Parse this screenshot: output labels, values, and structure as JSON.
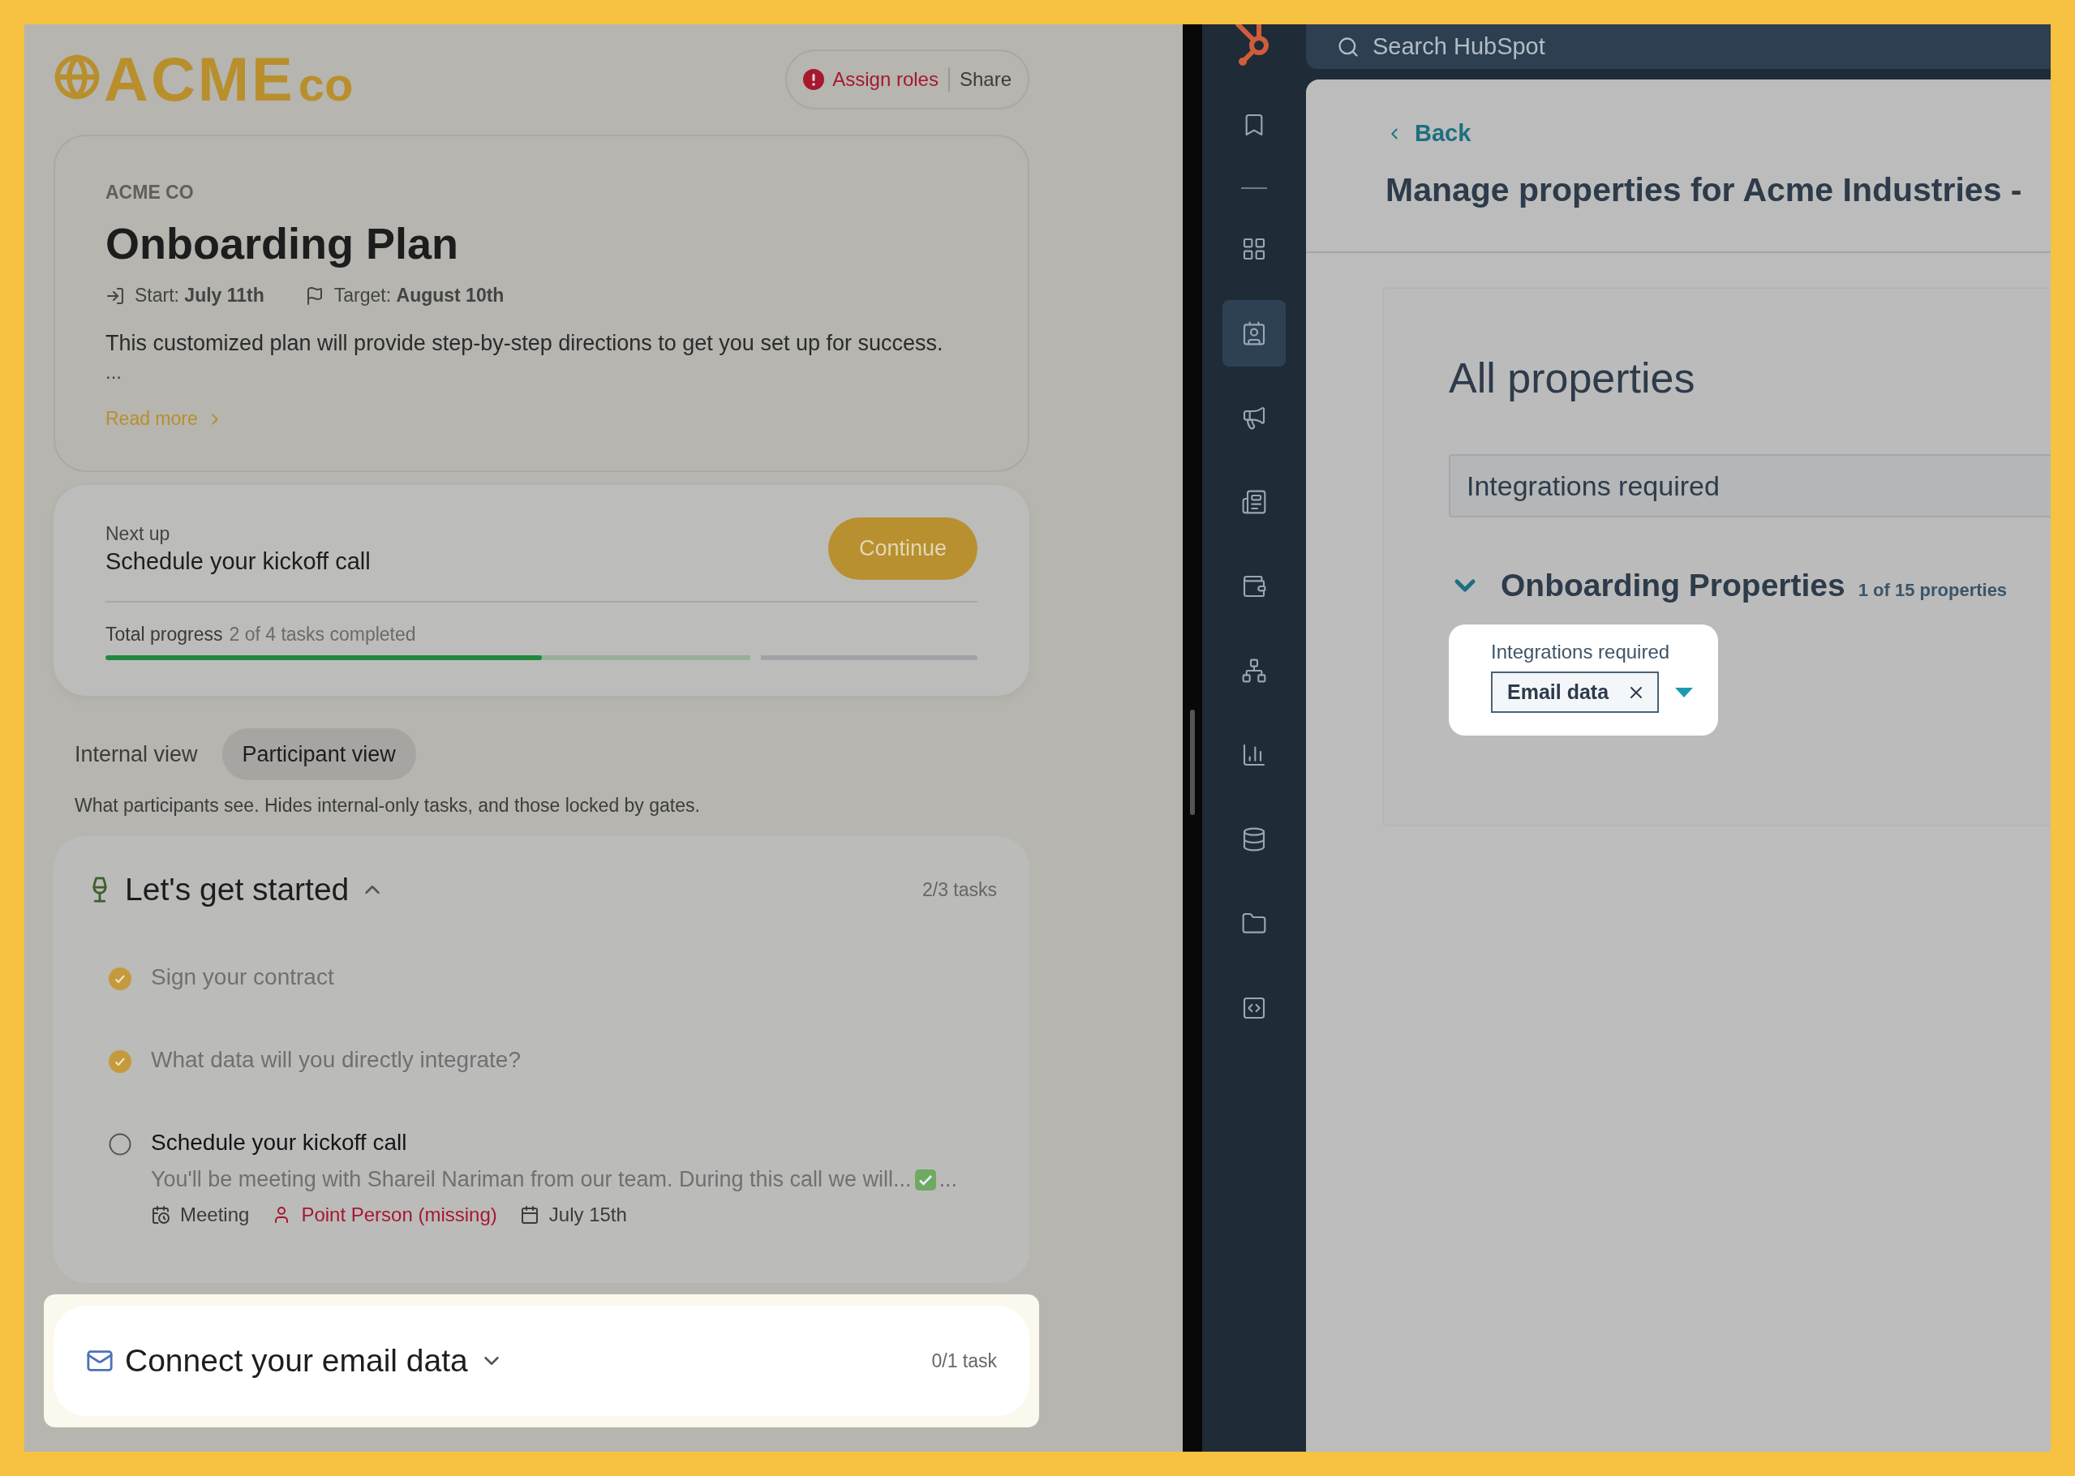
{
  "logo": {
    "text": "ACME",
    "suffix": "co"
  },
  "header_actions": {
    "assign_roles": "Assign roles",
    "share": "Share"
  },
  "plan": {
    "company": "ACME CO",
    "title": "Onboarding Plan",
    "start_label": "Start:",
    "start": "July 11th",
    "target_label": "Target:",
    "target": "August 10th",
    "description": "This customized plan will provide step-by-step directions to get you set up for success.",
    "ellipsis": "...",
    "read_more": "Read more"
  },
  "next_up": {
    "label": "Next up",
    "task": "Schedule your kickoff call",
    "button": "Continue",
    "progress_label": "Total progress",
    "progress_text": "2 of 4 tasks completed",
    "level": 0.5
  },
  "view_tabs": [
    {
      "label": "Internal view",
      "selected": false
    },
    {
      "label": "Participant view",
      "selected": true
    }
  ],
  "view_hint": "What participants see. Hides internal-only tasks, and those locked by gates.",
  "sections": [
    {
      "title": "Let's get started",
      "count": "2/3 tasks",
      "expanded": true,
      "highlighted": false,
      "tasks": [
        {
          "title": "Sign your contract",
          "done": true
        },
        {
          "title": "What data will you directly integrate?",
          "done": true
        },
        {
          "title": "Schedule your kickoff call",
          "done": false,
          "description": "You'll be meeting with Shareil Nariman from our team.  During this call we will...",
          "description_tail": "...",
          "meta": [
            {
              "kind": "type",
              "text": "Meeting",
              "missing": false
            },
            {
              "kind": "owner",
              "text": "Point Person (missing)",
              "missing": true
            },
            {
              "kind": "date",
              "text": "July 15th",
              "missing": false
            }
          ]
        }
      ]
    },
    {
      "title": "Connect your email data",
      "count": "0/1 task",
      "expanded": false,
      "highlighted": true
    }
  ],
  "nav": {
    "search_placeholder": "Search HubSpot",
    "items": [
      {
        "selected": false
      },
      {
        "selected": false
      },
      {
        "selected": true
      },
      {
        "selected": false
      },
      {
        "selected": false
      },
      {
        "selected": false
      },
      {
        "selected": false
      },
      {
        "selected": false
      },
      {
        "selected": false
      },
      {
        "selected": false
      },
      {
        "selected": false
      }
    ]
  },
  "page": {
    "back": "Back",
    "title": "Manage properties for Acme Industries -"
  },
  "properties": {
    "heading": "All properties",
    "search_value": "Integrations required",
    "group": {
      "title": "Onboarding Properties",
      "count": "1 of 15 properties",
      "expanded": true
    },
    "field": {
      "label": "Integrations required",
      "tags": [
        "Email data"
      ]
    }
  }
}
